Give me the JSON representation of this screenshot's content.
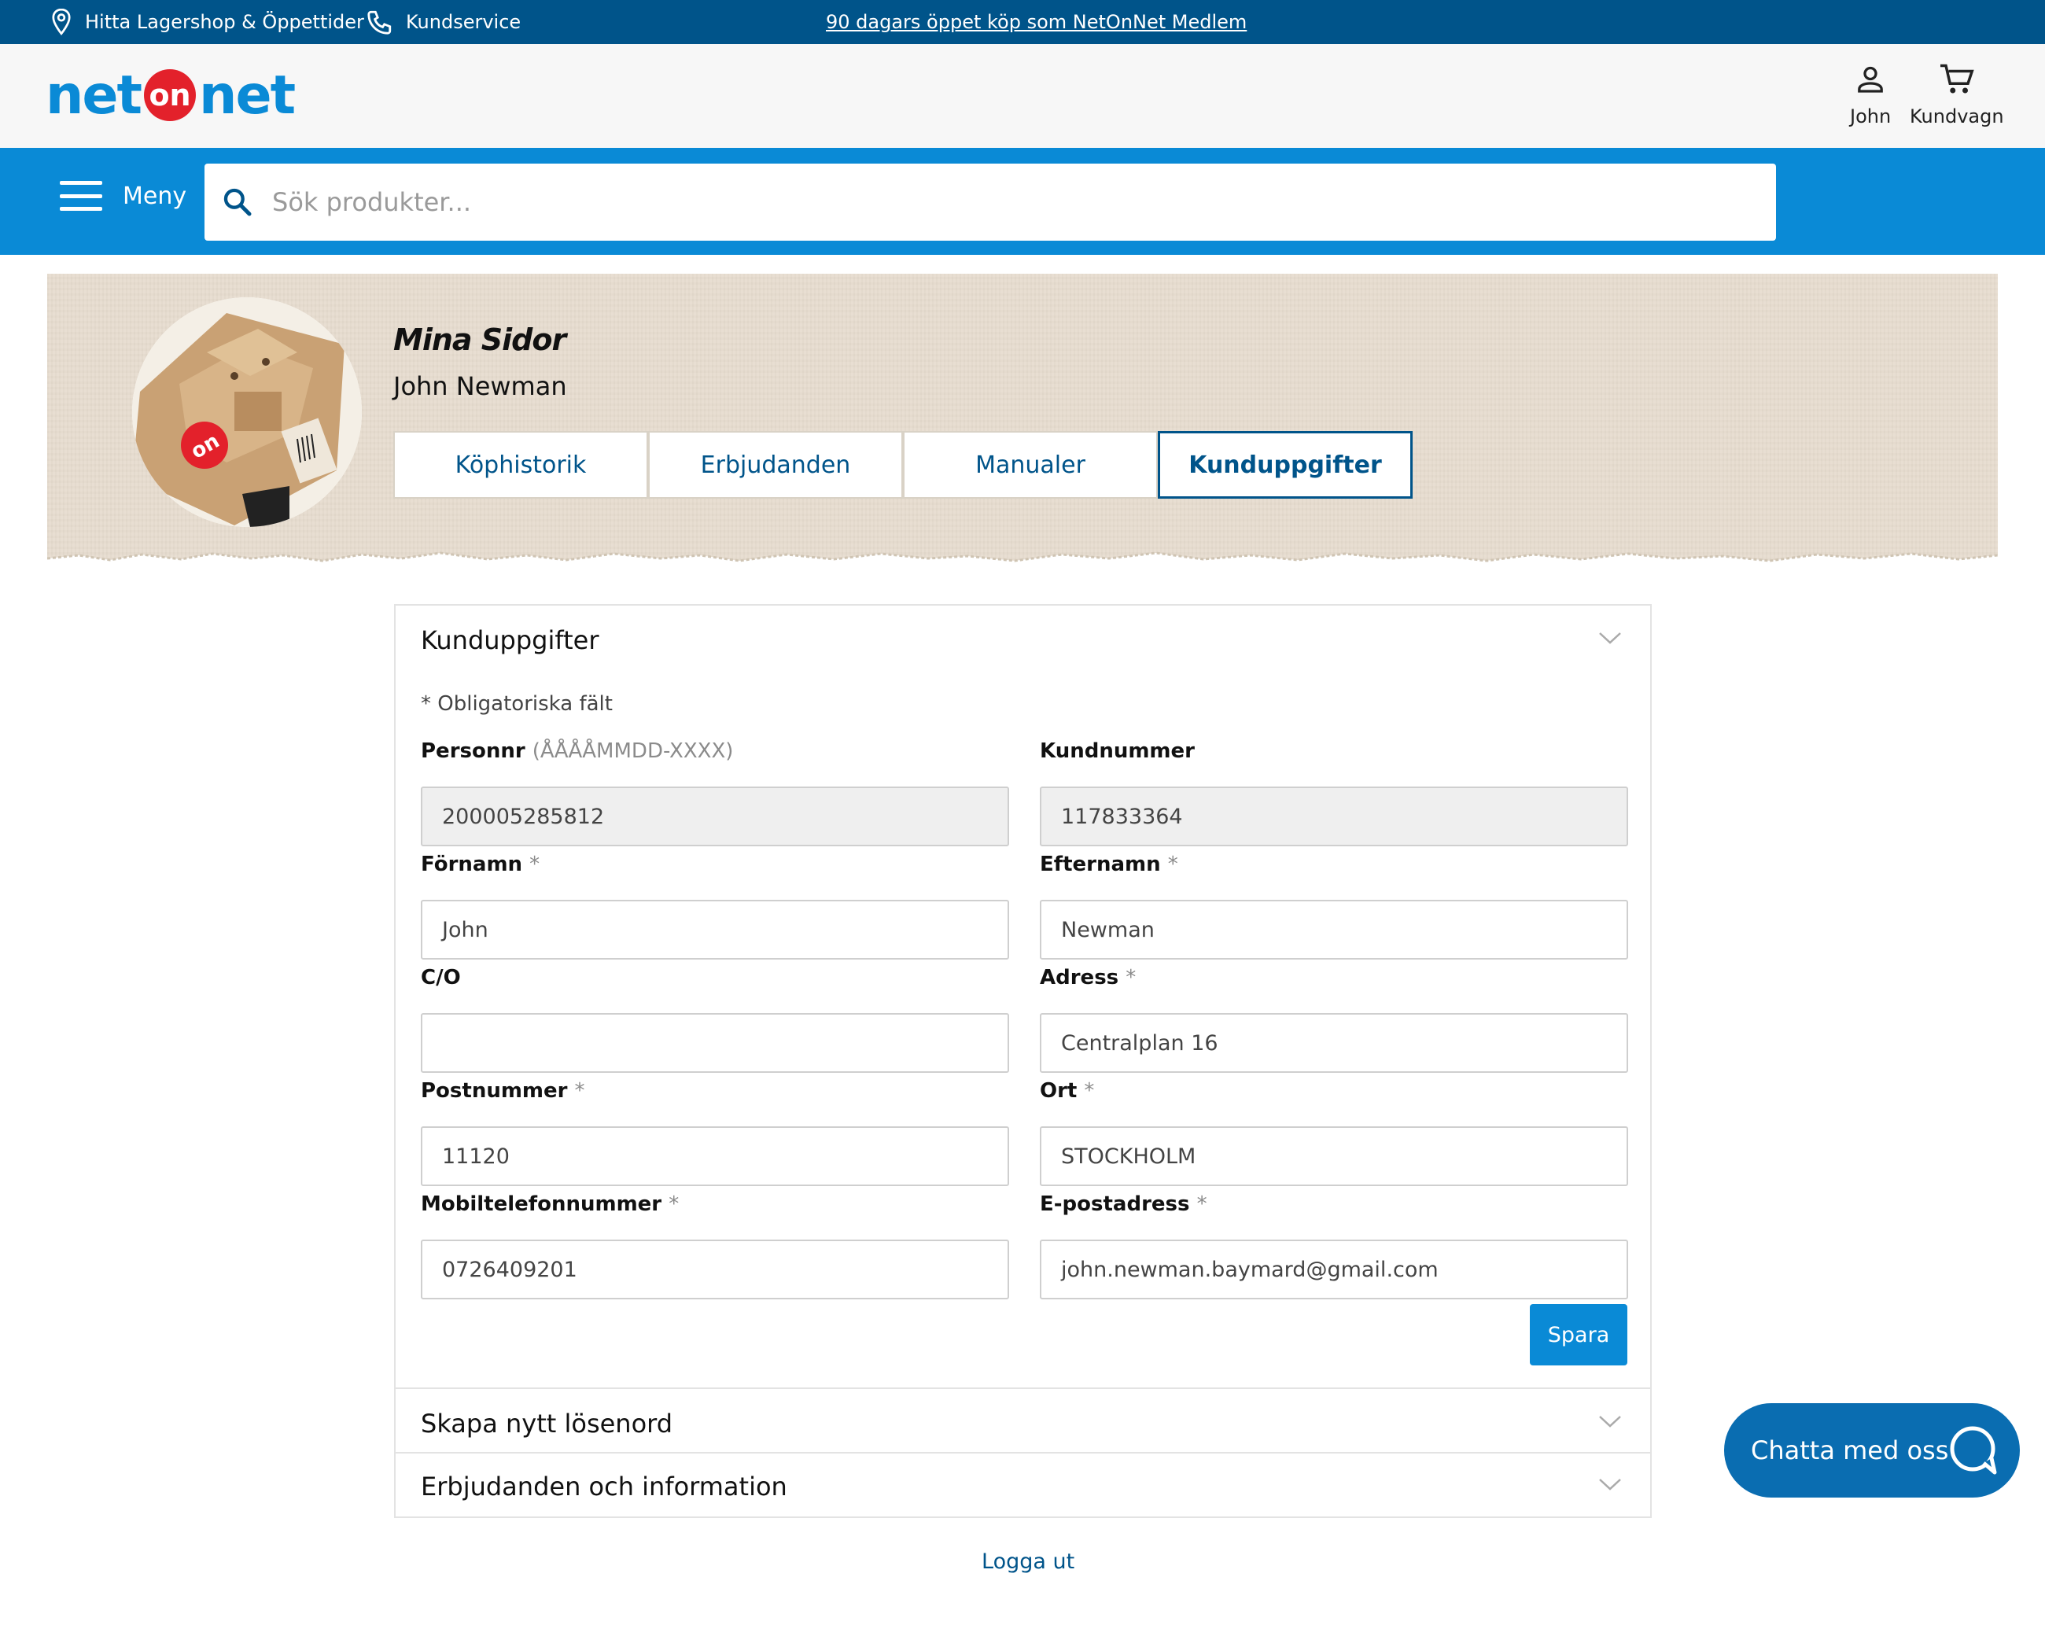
{
  "topbar": {
    "find_store": "Hitta Lagershop & Öppettider",
    "customer_service": "Kundservice",
    "promo": "90 dagars öppet köp som NetOnNet Medlem"
  },
  "header": {
    "logo_left": "net",
    "logo_mid": "on",
    "logo_right": "net",
    "account_label": "John",
    "cart_label": "Kundvagn"
  },
  "nav": {
    "menu_label": "Meny",
    "search_placeholder": "Sök produkter..."
  },
  "profile": {
    "heading": "Mina Sidor",
    "name": "John Newman",
    "tabs": [
      {
        "label": "Köphistorik",
        "active": false
      },
      {
        "label": "Erbjudanden",
        "active": false
      },
      {
        "label": "Manualer",
        "active": false
      },
      {
        "label": "Kunduppgifter",
        "active": true
      }
    ]
  },
  "form": {
    "section_title": "Kunduppgifter",
    "required_note": "* Obligatoriska fält",
    "fields": {
      "personnr": {
        "label": "Personnr",
        "hint": "(ÅÅÅÅMMDD-XXXX)",
        "value": "200005285812"
      },
      "kundnummer": {
        "label": "Kundnummer",
        "value": "117833364"
      },
      "fornamn": {
        "label": "Förnamn",
        "star": "*",
        "value": "John"
      },
      "efternamn": {
        "label": "Efternamn",
        "star": "*",
        "value": "Newman"
      },
      "co": {
        "label": "C/O",
        "value": ""
      },
      "adress": {
        "label": "Adress",
        "star": "*",
        "value": "Centralplan 16"
      },
      "postnummer": {
        "label": "Postnummer",
        "star": "*",
        "value": "11120"
      },
      "ort": {
        "label": "Ort",
        "star": "*",
        "value": "STOCKHOLM"
      },
      "mobil": {
        "label": "Mobiltelefonnummer",
        "star": "*",
        "value": "0726409201"
      },
      "epost": {
        "label": "E-postadress",
        "star": "*",
        "value": "john.newman.baymard@gmail.com"
      }
    },
    "save_label": "Spara"
  },
  "sections": {
    "password": "Skapa nytt lösenord",
    "offers": "Erbjudanden och information"
  },
  "logout_label": "Logga ut",
  "chat_label": "Chatta med oss",
  "colors": {
    "topbar": "#00548a",
    "nav": "#0a8ad6",
    "accent": "#0a8ad6",
    "logo_on": "#e3212b",
    "chat": "#0a6db1"
  }
}
